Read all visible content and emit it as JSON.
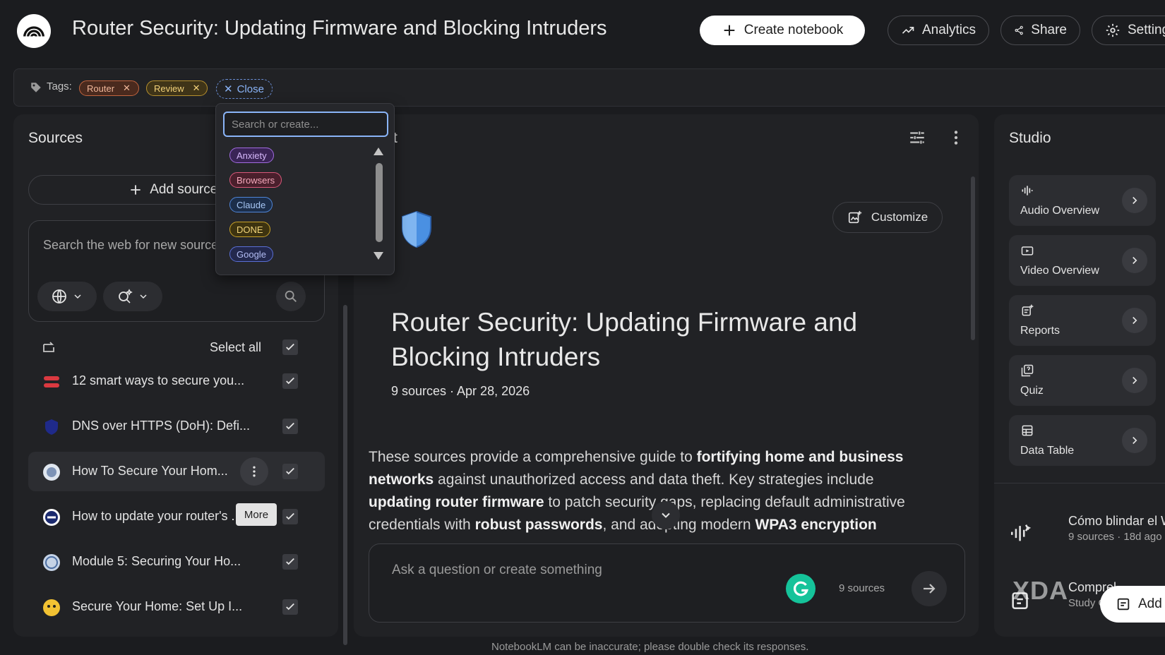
{
  "header": {
    "title": "Router Security: Updating Firmware and Blocking Intruders",
    "create_notebook": "Create notebook",
    "analytics": "Analytics",
    "share": "Share",
    "settings": "Setting"
  },
  "tags": {
    "label": "Tags:",
    "applied": [
      {
        "label": "Router",
        "color": "#c2643e"
      },
      {
        "label": "Review",
        "color": "#b58f2e"
      }
    ],
    "close_label": "Close",
    "dropdown": {
      "placeholder": "Search or create...",
      "options": [
        {
          "label": "Anxiety",
          "color": "#a16be0"
        },
        {
          "label": "Browsers",
          "color": "#d9587a"
        },
        {
          "label": "Claude",
          "color": "#4f86d9"
        },
        {
          "label": "DONE",
          "color": "#c9a227"
        },
        {
          "label": "Google",
          "color": "#5a6fd6"
        }
      ]
    }
  },
  "sources": {
    "heading": "Sources",
    "add_label": "Add sources",
    "search_placeholder": "Search the web for new sources",
    "select_all": "Select all",
    "more_tooltip": "More",
    "items": [
      {
        "title": "12 smart ways to secure you...",
        "icon": "expressvpn-icon"
      },
      {
        "title": "DNS over HTTPS (DoH): Defi...",
        "icon": "shield-icon"
      },
      {
        "title": "How To Secure Your Hom...",
        "icon": "globe-icon"
      },
      {
        "title": "How to update your router's ...",
        "icon": "link-icon"
      },
      {
        "title": "Module 5: Securing Your Ho...",
        "icon": "globe-icon"
      },
      {
        "title": "Secure Your Home: Set Up I...",
        "icon": "emoji-icon"
      }
    ]
  },
  "chat": {
    "heading": "t",
    "customize": "Customize",
    "notebook_title": "Router Security: Updating Firmware and Blocking Intruders",
    "meta": "9 sources · Apr 28, 2026",
    "summary": {
      "s1": "These sources provide a comprehensive guide to ",
      "b1": "fortifying home and business networks",
      "s2": " against unauthorized access and data theft. Key strategies include ",
      "b2": "updating router firmware",
      "s3": " to patch security gaps, replacing default administrative credentials with ",
      "b3": "robust passwords",
      "s4": ", and adopting modern ",
      "b4": "WPA3 encryption"
    },
    "composer_placeholder": "Ask a question or create something",
    "source_count": "9 sources"
  },
  "studio": {
    "heading": "Studio",
    "cards": [
      {
        "label": "Audio Overview",
        "icon": "audio-waveform-icon"
      },
      {
        "label": "Video Overview",
        "icon": "video-icon"
      },
      {
        "label": "Reports",
        "icon": "reports-icon"
      },
      {
        "label": "Quiz",
        "icon": "quiz-icon"
      },
      {
        "label": "Data Table",
        "icon": "table-icon"
      }
    ],
    "notes": [
      {
        "title": "Cómo blindar el W",
        "subtitle": "9 sources · 18d ago",
        "icon": "audio-waveform-icon"
      },
      {
        "title": "Comprel",
        "subtitle": "Study Gu",
        "icon": "study-guide-icon"
      }
    ],
    "add_note": "Add"
  },
  "watermark": "XDA",
  "footer": "NotebookLM can be inaccurate; please double check its responses."
}
